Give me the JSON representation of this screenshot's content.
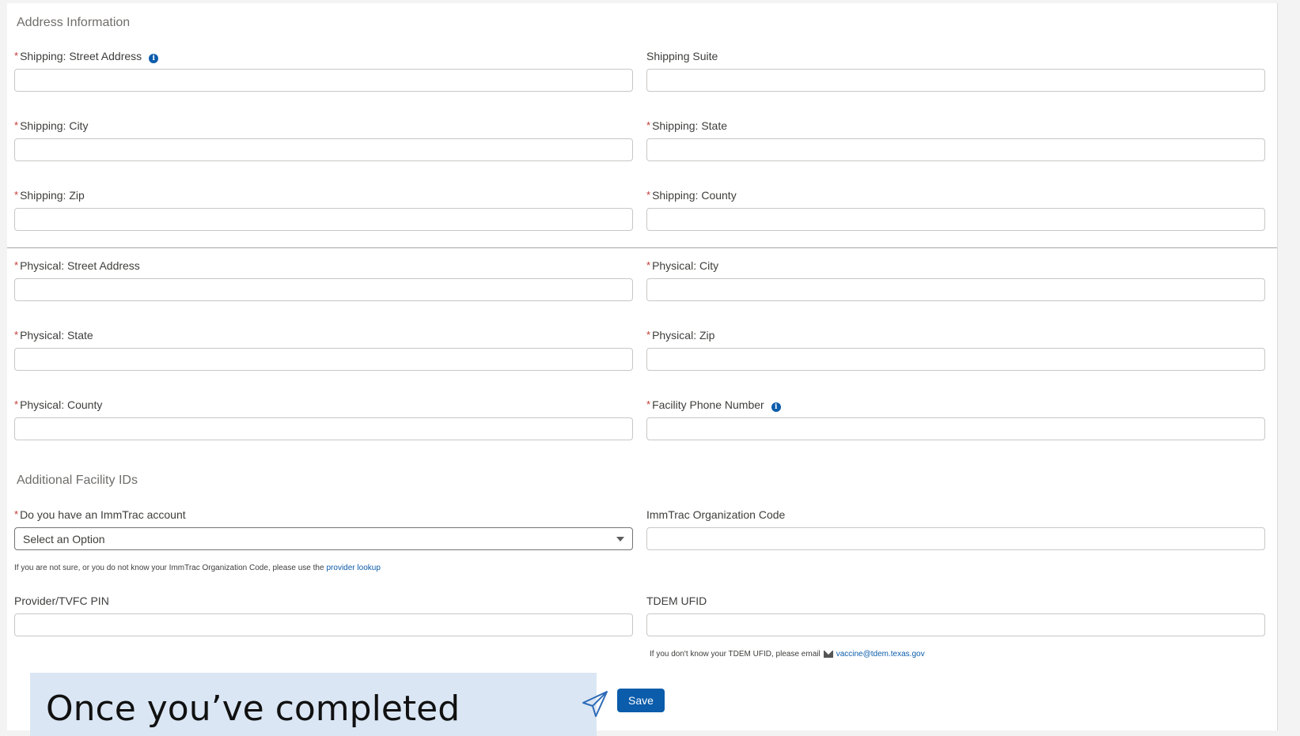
{
  "address_section": {
    "title": "Address Information",
    "fields": {
      "shipping_street": {
        "label": "Shipping: Street Address",
        "value": ""
      },
      "shipping_suite": {
        "label": "Shipping Suite",
        "value": ""
      },
      "shipping_city": {
        "label": "Shipping: City",
        "value": ""
      },
      "shipping_state": {
        "label": "Shipping: State",
        "value": ""
      },
      "shipping_zip": {
        "label": "Shipping: Zip",
        "value": ""
      },
      "shipping_county": {
        "label": "Shipping: County",
        "value": ""
      },
      "physical_street": {
        "label": "Physical: Street Address",
        "value": ""
      },
      "physical_city": {
        "label": "Physical: City",
        "value": ""
      },
      "physical_state": {
        "label": "Physical: State",
        "value": ""
      },
      "physical_zip": {
        "label": "Physical: Zip",
        "value": ""
      },
      "physical_county": {
        "label": "Physical: County",
        "value": ""
      },
      "facility_phone": {
        "label": "Facility Phone Number",
        "value": ""
      }
    }
  },
  "facility_ids_section": {
    "title": "Additional Facility IDs",
    "immtrac_account": {
      "label": "Do you have an ImmTrac account",
      "selected": "Select an Option"
    },
    "immtrac_org_code": {
      "label": "ImmTrac Organization Code",
      "value": ""
    },
    "immtrac_help": {
      "text": "If you are not sure, or you do not know your ImmTrac Organization Code, please use the",
      "link": "provider lookup"
    },
    "provider_pin": {
      "label": "Provider/TVFC PIN",
      "value": ""
    },
    "tdem_ufid": {
      "label": "TDEM UFID",
      "value": ""
    },
    "tdem_help": {
      "text": "If you don't know your TDEM UFID, please email",
      "email": "vaccine@tdem.texas.gov"
    }
  },
  "required_marker": "*",
  "info_glyph": "i",
  "save_label": "Save",
  "callout_text": "Once you’ve completed",
  "colors": {
    "accent": "#0b5cab",
    "required": "#c23934",
    "callout_bg": "#dae6f3"
  },
  "icons": [
    "info-icon",
    "chevron-down-icon",
    "mail-icon",
    "paper-plane-icon"
  ]
}
